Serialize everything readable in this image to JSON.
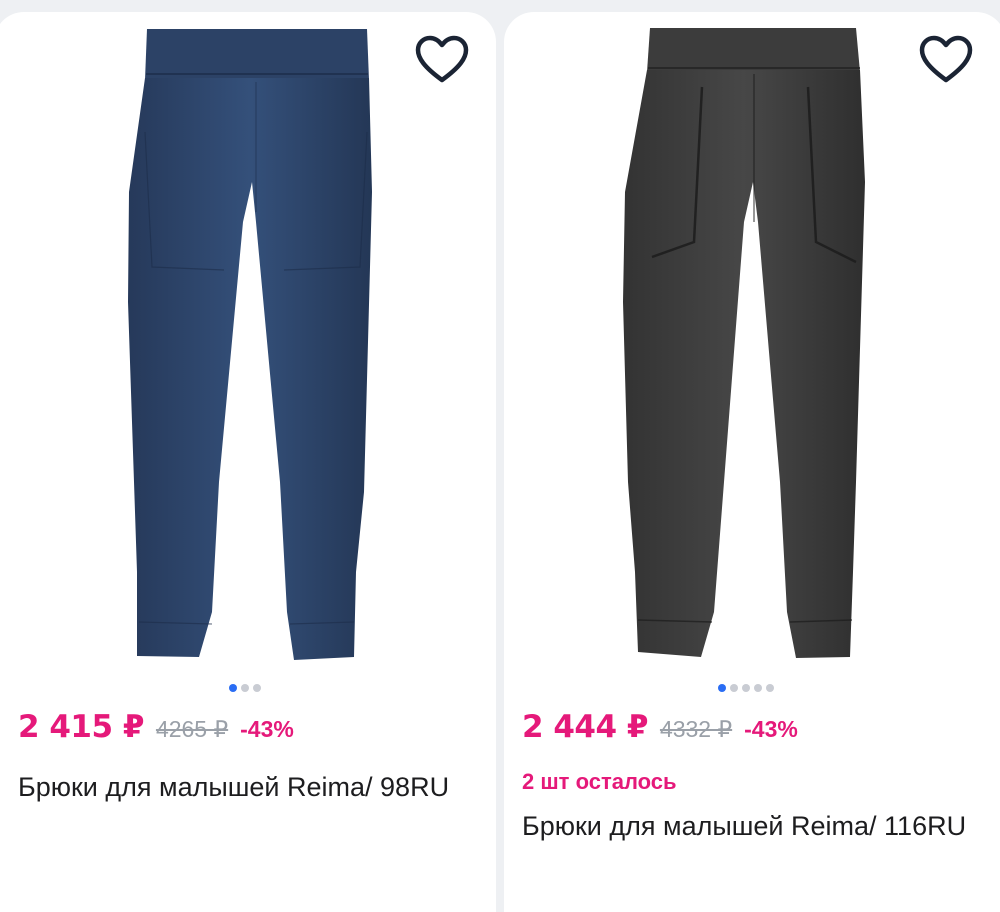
{
  "products": [
    {
      "price": "2 415 ₽",
      "old_price": "4265 ₽",
      "discount": "-43%",
      "stock": "",
      "title": "Брюки для малышей Reima/ 98RU",
      "color": "#2e4466",
      "photo_dots": 3,
      "active_dot": 0,
      "favorite_icon": "heart-outline-icon"
    },
    {
      "price": "2 444 ₽",
      "old_price": "4332 ₽",
      "discount": "-43%",
      "stock": "2 шт осталось",
      "title": "Брюки для малышей Reima/ 116RU",
      "color": "#3a3a3a",
      "photo_dots": 5,
      "active_dot": 0,
      "favorite_icon": "heart-outline-icon"
    }
  ],
  "theme": {
    "accent": "#e5197a",
    "strike": "#9aa0a8",
    "dot_active": "#2a6df4",
    "dot_inactive": "#c9ccd3"
  }
}
